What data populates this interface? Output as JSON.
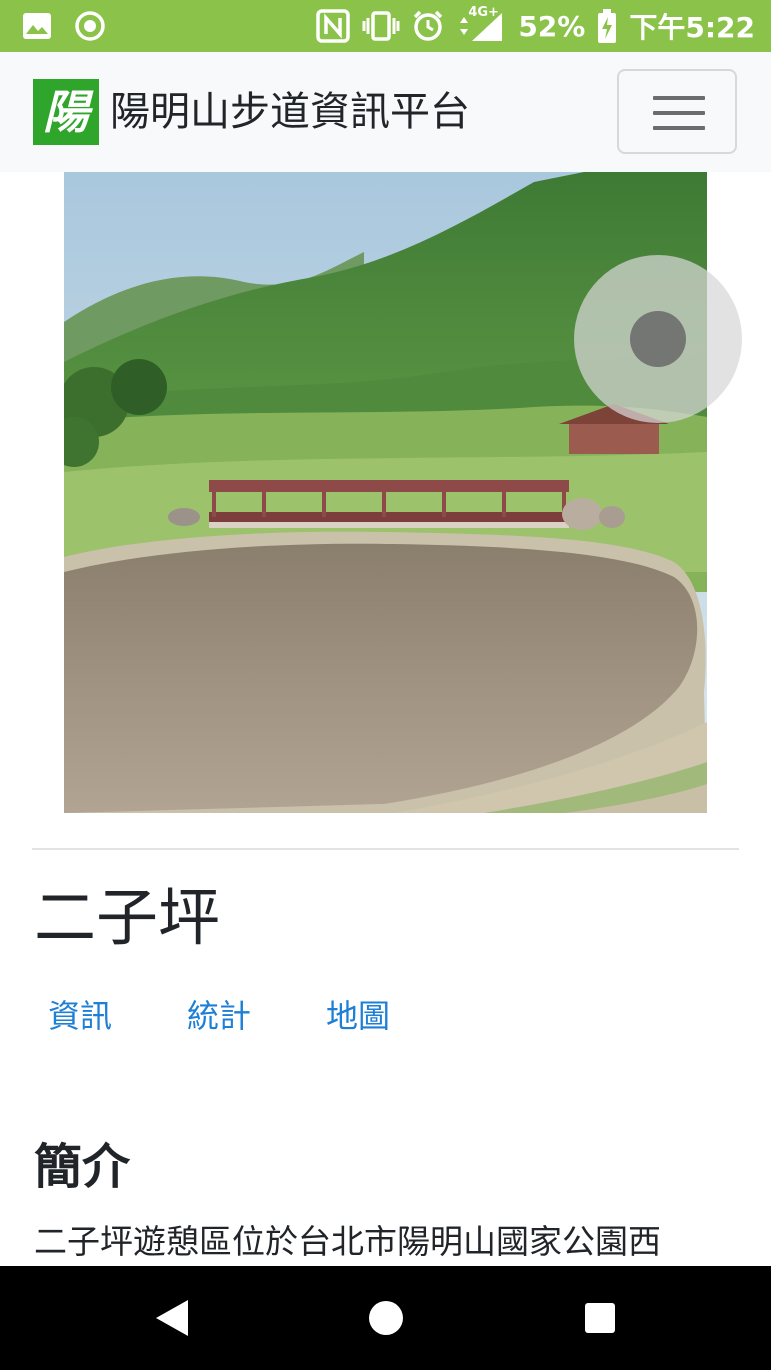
{
  "status_bar": {
    "icons_left": [
      "image-icon",
      "circle-dot-icon"
    ],
    "icons_right": [
      "nfc-icon",
      "vibrate-icon",
      "alarm-icon",
      "signal-4g-icon"
    ],
    "network": "4G+",
    "battery_percent": "52%",
    "time": "下午5:22"
  },
  "navbar": {
    "logo_glyph": "陽",
    "brand": "陽明山步道資訊平台",
    "menu_icon": "hamburger-icon"
  },
  "trail": {
    "name": "二子坪",
    "tabs": [
      {
        "label": "資訊"
      },
      {
        "label": "統計"
      },
      {
        "label": "地圖"
      }
    ]
  },
  "intro": {
    "heading": "簡介",
    "text": "二子坪遊憩區位於台北市陽明山國家公園西"
  },
  "system_nav": {
    "back_icon": "back-triangle-icon",
    "home_icon": "home-circle-icon",
    "recents_icon": "recents-square-icon"
  },
  "colors": {
    "status_bar": "#8bc34a",
    "logo_green": "#2fa52b",
    "link_blue": "#1e7fd6",
    "navbar_bg": "#f8f9fa"
  }
}
